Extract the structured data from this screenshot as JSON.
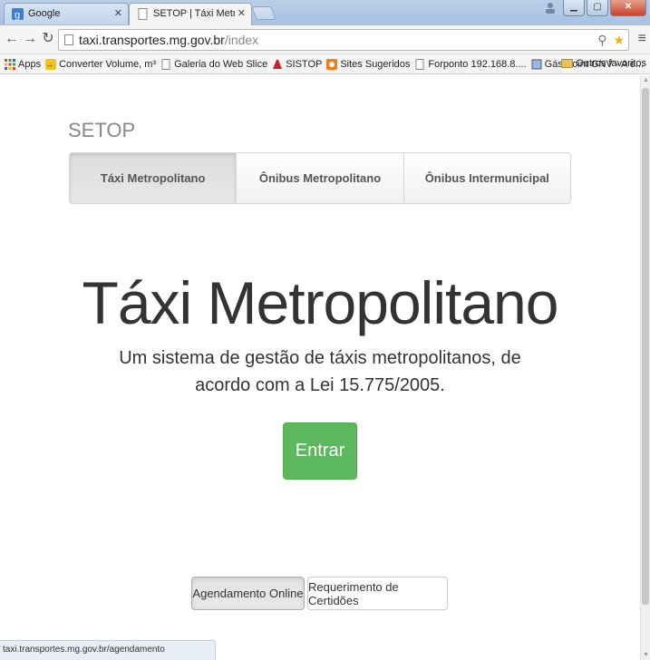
{
  "browser": {
    "tabs": [
      {
        "label": "Google",
        "active": false
      },
      {
        "label": "SETOP | Táxi Metropolitan",
        "active": true
      }
    ],
    "address": {
      "host": "taxi.transportes.mg.gov.br",
      "path": "/index"
    },
    "bookmarks": [
      {
        "label": "Apps",
        "icon": "apps-grid-icon"
      },
      {
        "label": "Converter Volume, m³",
        "icon": "converter-icon"
      },
      {
        "label": "Galeria do Web Slice",
        "icon": "page-icon"
      },
      {
        "label": "SISTOP",
        "icon": "sistop-icon"
      },
      {
        "label": "Sites Sugeridos",
        "icon": "sites-icon"
      },
      {
        "label": "Forponto 192.168.8....",
        "icon": "page-icon"
      },
      {
        "label": "Gás Point GNV - A e...",
        "icon": "gas-icon"
      }
    ],
    "bookmarks_more": "»",
    "other_bookmarks": "Outros favoritos",
    "status_url": "taxi.transportes.mg.gov.br/agendamento"
  },
  "page": {
    "brand": "SETOP",
    "nav": [
      {
        "label": "Táxi Metropolitano",
        "active": true
      },
      {
        "label": "Ônibus Metropolitano",
        "active": false
      },
      {
        "label": "Ônibus Intermunicipal",
        "active": false
      }
    ],
    "hero_title": "Táxi Metropolitano",
    "hero_subtitle": "Um sistema de gestão de táxis metropolitanos, de acordo com a Lei 15.775/2005.",
    "enter_label": "Entrar",
    "footer_buttons": [
      {
        "label": "Agendamento Online"
      },
      {
        "label": "Requerimento de Certidões"
      }
    ]
  },
  "colors": {
    "success": "#5cb85c",
    "brand_text": "#888888"
  }
}
